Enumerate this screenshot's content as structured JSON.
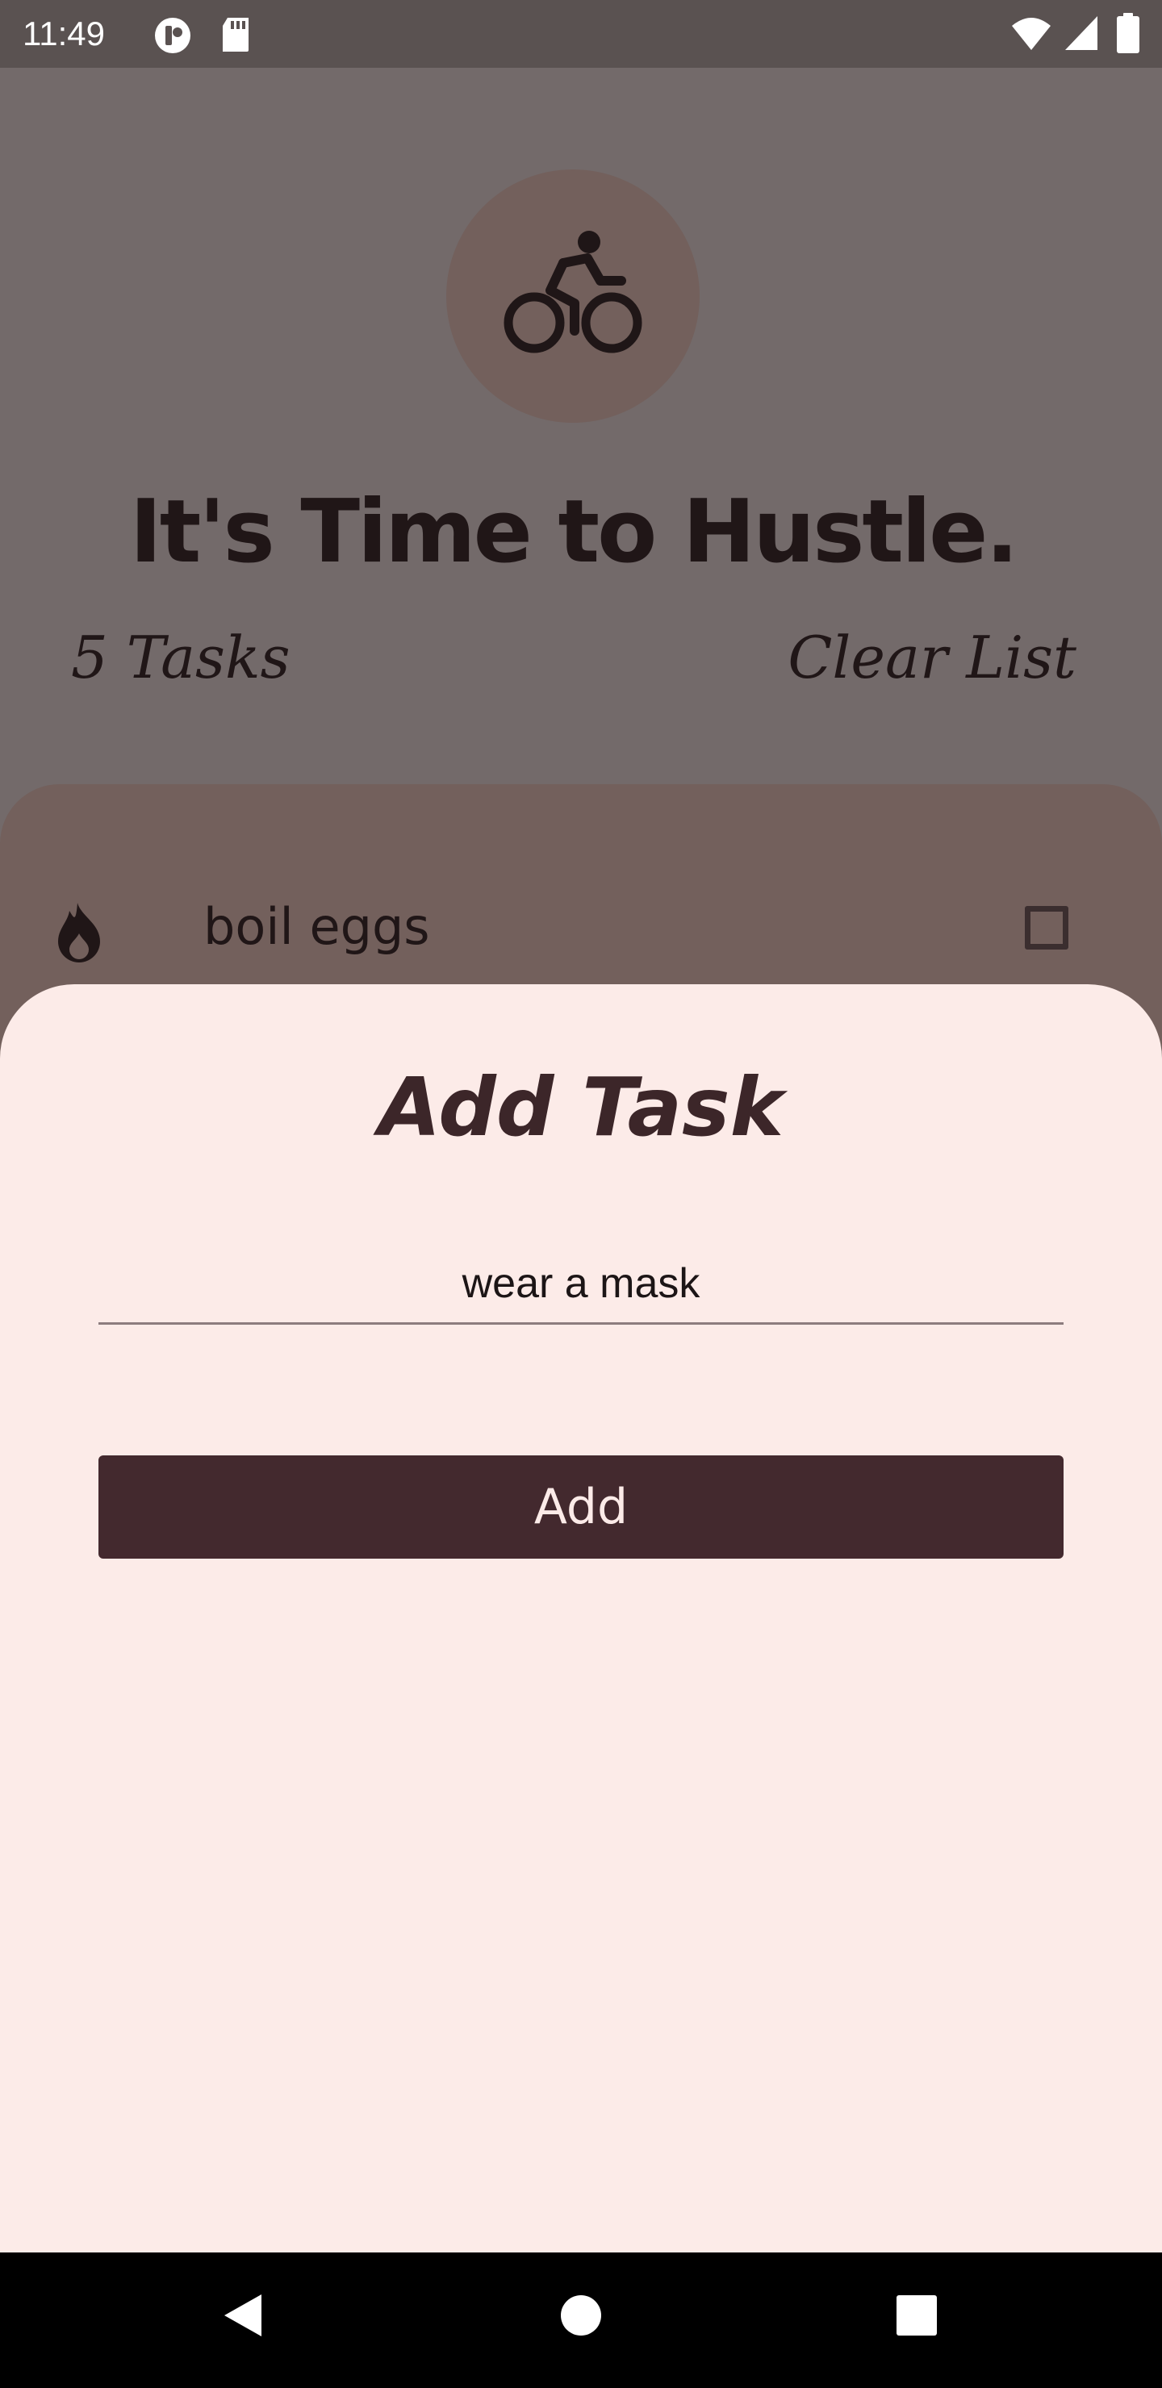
{
  "status_bar": {
    "time": "11:49"
  },
  "header": {
    "headline": "It's Time to Hustle.",
    "task_count": "5 Tasks",
    "clear_list_label": "Clear List"
  },
  "task_list": {
    "items": [
      {
        "label": "boil eggs",
        "checked": false
      }
    ]
  },
  "add_task_sheet": {
    "title": "Add Task",
    "input_value": "wear a mask",
    "add_button_label": "Add"
  },
  "icons": {
    "status": [
      "notification-icon",
      "sd-card-icon",
      "wifi-icon",
      "signal-icon",
      "battery-icon"
    ],
    "header": "bicycle-icon",
    "list_item": "fire-icon",
    "nav": [
      "back-icon",
      "home-icon",
      "recents-icon"
    ]
  },
  "colors": {
    "scrim_background": "#736a6a",
    "accent_dark": "#43292e",
    "sheet_background": "#fcebe8",
    "panel_background": "#73605c"
  }
}
